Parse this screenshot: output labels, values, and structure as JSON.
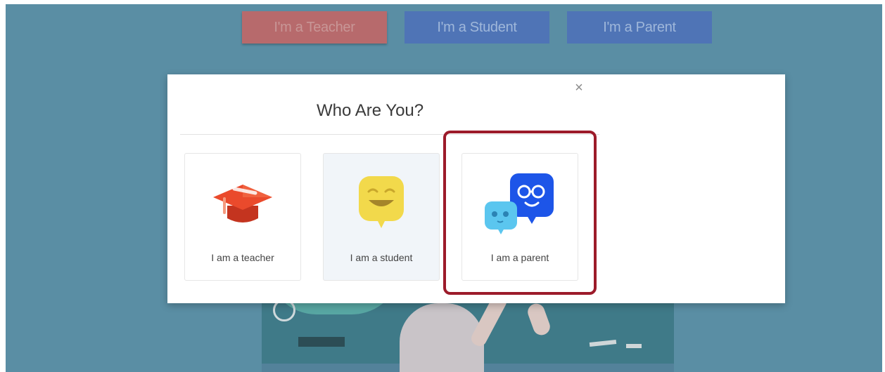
{
  "header": {
    "teacher_button": "I'm a Teacher",
    "student_button": "I'm a Student",
    "parent_button": "I'm a Parent"
  },
  "modal": {
    "title": "Who Are You?",
    "close_symbol": "×",
    "cards": [
      {
        "label": "I am a teacher",
        "icon": "graduation-cap-icon",
        "color": "#e8452a"
      },
      {
        "label": "I am a student",
        "icon": "smiling-student-avatar-icon",
        "color": "#f2d94b"
      },
      {
        "label": "I am a parent",
        "icon": "parent-and-child-avatars-icon",
        "color": "#1d55e8"
      }
    ]
  },
  "colors": {
    "overlay_background": "#5a8ea4",
    "highlight_border": "#9c1b2a"
  }
}
